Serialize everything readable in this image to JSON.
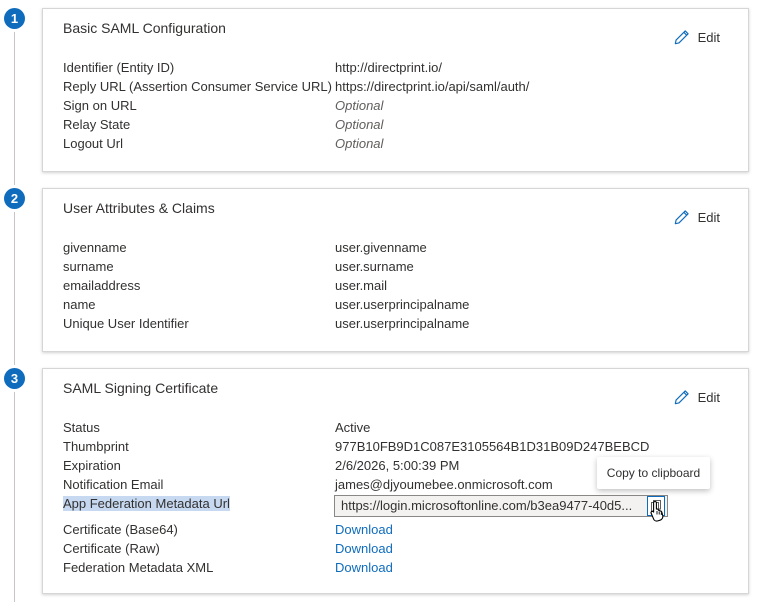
{
  "steps": [
    "1",
    "2",
    "3"
  ],
  "edit_label": "Edit",
  "section1": {
    "title": "Basic SAML Configuration",
    "rows": [
      {
        "label": "Identifier (Entity ID)",
        "value": "http://directprint.io/"
      },
      {
        "label": "Reply URL (Assertion Consumer Service URL)",
        "value": "https://directprint.io/api/saml/auth/"
      },
      {
        "label": "Sign on URL",
        "value": "Optional"
      },
      {
        "label": "Relay State",
        "value": "Optional"
      },
      {
        "label": "Logout Url",
        "value": "Optional"
      }
    ]
  },
  "section2": {
    "title": "User Attributes & Claims",
    "rows": [
      {
        "label": "givenname",
        "value": "user.givenname"
      },
      {
        "label": "surname",
        "value": "user.surname"
      },
      {
        "label": "emailaddress",
        "value": "user.mail"
      },
      {
        "label": "name",
        "value": "user.userprincipalname"
      },
      {
        "label": "Unique User Identifier",
        "value": "user.userprincipalname"
      }
    ]
  },
  "section3": {
    "title": "SAML Signing Certificate",
    "rows": [
      {
        "label": "Status",
        "value": "Active"
      },
      {
        "label": "Thumbprint",
        "value": "977B10FB9D1C087E3105564B1D31B09D247BEBCD"
      },
      {
        "label": "Expiration",
        "value": "2/6/2026, 5:00:39 PM"
      },
      {
        "label": "Notification Email",
        "value": "james@djyoumebee.onmicrosoft.com"
      },
      {
        "label": "App Federation Metadata Url",
        "value": "https://login.microsoftonline.com/b3ea9477-40d5..."
      },
      {
        "label": "Certificate (Base64)",
        "value": "Download"
      },
      {
        "label": "Certificate (Raw)",
        "value": "Download"
      },
      {
        "label": "Federation Metadata XML",
        "value": "Download"
      }
    ]
  },
  "tooltip": "Copy to clipboard",
  "colors": {
    "accent": "#0f6cbd",
    "highlight": "#c7d9f1"
  },
  "icons": {
    "edit": "pencil-icon",
    "copy": "copy-icon",
    "cursor": "hand-pointer-icon"
  }
}
